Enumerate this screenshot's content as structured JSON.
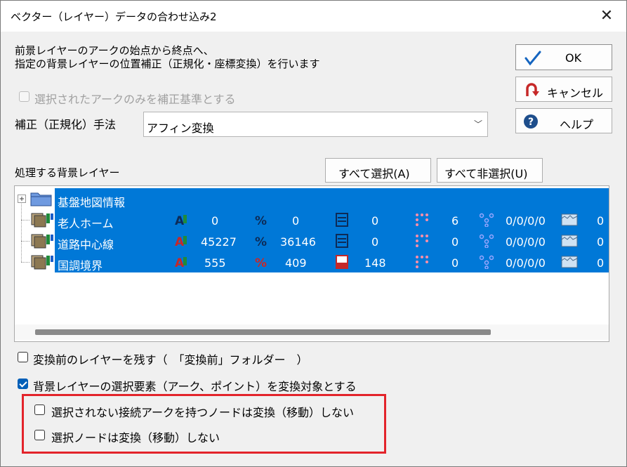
{
  "window": {
    "title": "ベクター（レイヤー）データの合わせ込み2"
  },
  "description": {
    "line1": "前景レイヤーのアークの始点から終点へ、",
    "line2": "指定の背景レイヤーの位置補正（正規化・座標変換）を行います"
  },
  "options": {
    "selected_arc_only": {
      "label": "選択されたアークのみを補正基準とする",
      "checked": false,
      "disabled": true
    },
    "keep_layer": {
      "label": "変換前のレイヤーを残す（　「変換前」フォルダー　）",
      "checked": false
    },
    "transform_selected": {
      "label": "背景レイヤーの選択要素（アーク、ポイント）を変換対象とする",
      "checked": true
    },
    "no_move_connected": {
      "label": "選択されない接続アークを持つノードは変換（移動）しない",
      "checked": false
    },
    "no_move_selected": {
      "label": "選択ノードは変換（移動）しない",
      "checked": false
    }
  },
  "method": {
    "label": "補正（正規化）手法",
    "value": "アフィン変換"
  },
  "buttons": {
    "ok": "OK",
    "cancel": "キャンセル",
    "help": "ヘルプ",
    "select_all": "すべて選択(A)",
    "deselect_all": "すべて非選択(U)"
  },
  "layers_label": "処理する背景レイヤー",
  "tree": {
    "group": "基盤地図情報",
    "rows": [
      {
        "name": "老人ホーム",
        "arcs": "0",
        "links": "0",
        "polys": "0",
        "points": "6",
        "nodes": "0/0/0/0",
        "meshes": "0"
      },
      {
        "name": "道路中心線",
        "arcs": "45227",
        "links": "36146",
        "polys": "0",
        "points": "0",
        "nodes": "0/0/0/0",
        "meshes": "0"
      },
      {
        "name": "国調境界",
        "arcs": "555",
        "links": "409",
        "polys": "148",
        "points": "0",
        "nodes": "0/0/0/0",
        "meshes": "0"
      }
    ]
  },
  "colors": {
    "selection": "#0078d7",
    "highlight_box": "#e3242b",
    "ok_check": "#1565c0",
    "cancel_arrow": "#c62828",
    "help_circle": "#1e4e8c"
  }
}
